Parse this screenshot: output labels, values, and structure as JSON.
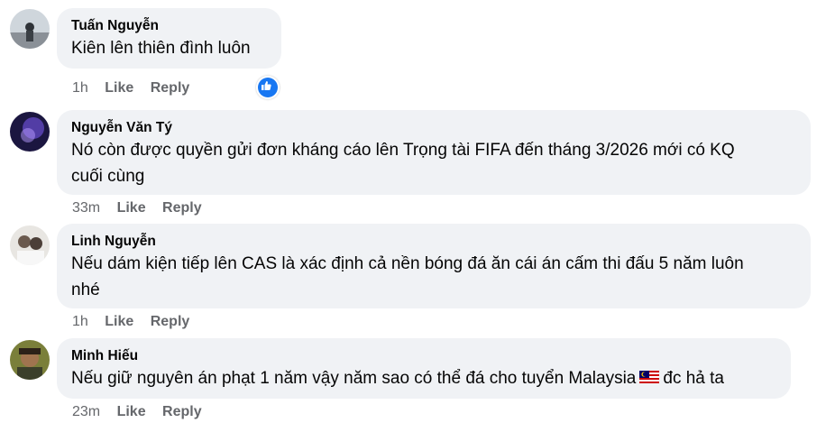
{
  "comments": [
    {
      "author": "Tuấn Nguyễn",
      "text_lines": [
        "Kiên lên thiên đình luôn"
      ],
      "time": "1h",
      "like_label": "Like",
      "reply_label": "Reply",
      "reaction": "like-icon"
    },
    {
      "author": "Nguyễn Văn Tý",
      "text_lines": [
        "Nó còn được quyền gửi đơn kháng cáo lên Trọng tài FIFA đến tháng 3/2026 mới có KQ",
        "cuối cùng"
      ],
      "time": "33m",
      "like_label": "Like",
      "reply_label": "Reply"
    },
    {
      "author": "Linh Nguyễn",
      "text_lines": [
        "Nếu dám kiện tiếp lên CAS là xác định cả nền bóng đá ăn cái án cấm thi đấu 5 năm luôn",
        "nhé"
      ],
      "time": "1h",
      "like_label": "Like",
      "reply_label": "Reply"
    },
    {
      "author": "Minh Hiếu",
      "text_before_flag": "Nếu giữ nguyên án phạt 1 năm vậy năm sao có thể đá cho tuyển Malaysia",
      "flag": "malaysia-flag-icon",
      "text_after_flag": "đc hả ta",
      "time": "23m",
      "like_label": "Like",
      "reply_label": "Reply"
    }
  ],
  "colors": {
    "bubble": "#f0f2f5",
    "meta_text": "#65676b",
    "like_blue": "#1877f2"
  }
}
